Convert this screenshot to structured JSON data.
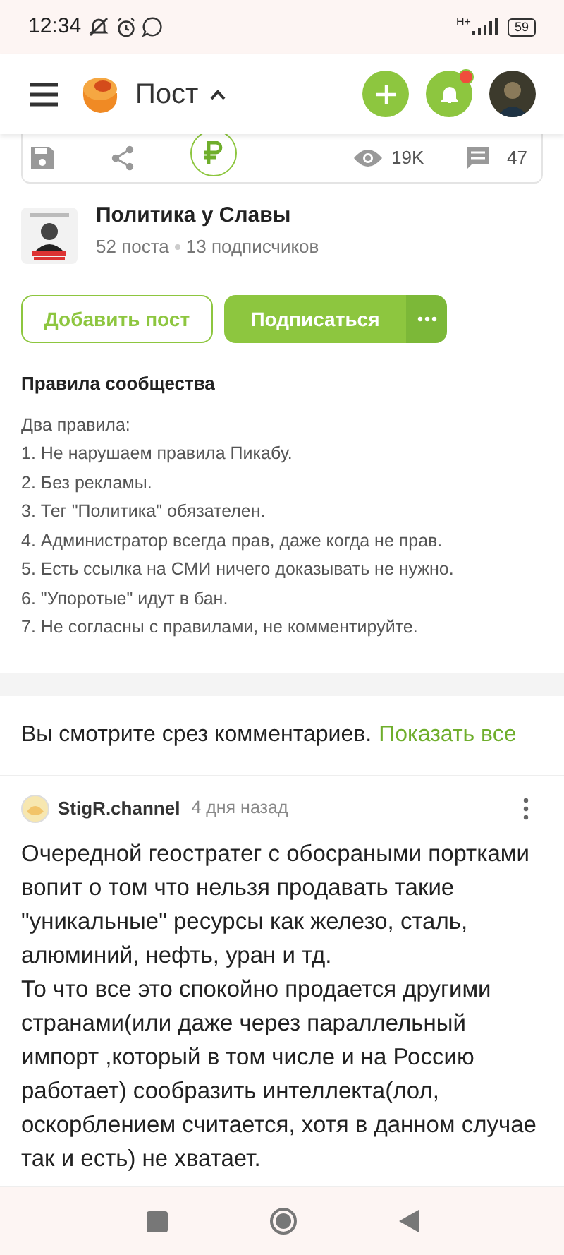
{
  "status_bar": {
    "time": "12:34",
    "network": "H+",
    "battery": "59"
  },
  "header": {
    "title": "Пост",
    "notifications_unread": true
  },
  "post_actions": {
    "views": "19K",
    "comments": "47"
  },
  "community": {
    "name": "Политика у Славы",
    "posts": "52 поста",
    "subscribers": "13 подписчиков",
    "add_button": "Добавить пост",
    "subscribe_button": "Подписаться",
    "rules_title": "Правила сообщества",
    "rules": [
      "Два правила:",
      "1. Не нарушаем правила Пикабу.",
      "2. Без рекламы.",
      "3. Тег \"Политика\" обязателен.",
      "4. Администратор всегда прав, даже когда не прав.",
      "5. Есть ссылка на СМИ ничего доказывать не нужно.",
      "6. \"Упоротые\" идут в бан.",
      "7. Не согласны с правилами, не комментируйте."
    ]
  },
  "comments_notice": {
    "text": "Вы смотрите срез комментариев.",
    "link": "Показать все"
  },
  "comment": {
    "author": "StigR.channel",
    "time": "4 дня назад",
    "paragraphs": [
      "Очередной геостратег с обосраными портками вопит о том что нельзя продавать такие \"уникальные\" ресурсы как железо, сталь, алюминий, нефть, уран и тд.",
      "То что все это спокойно продается другими странами(или даже через параллельный импорт ,который в том числе и на Россию работает) сообразить интеллекта(лол, оскорблением считается, хотя в данном случае так и есть) не хватает."
    ]
  }
}
